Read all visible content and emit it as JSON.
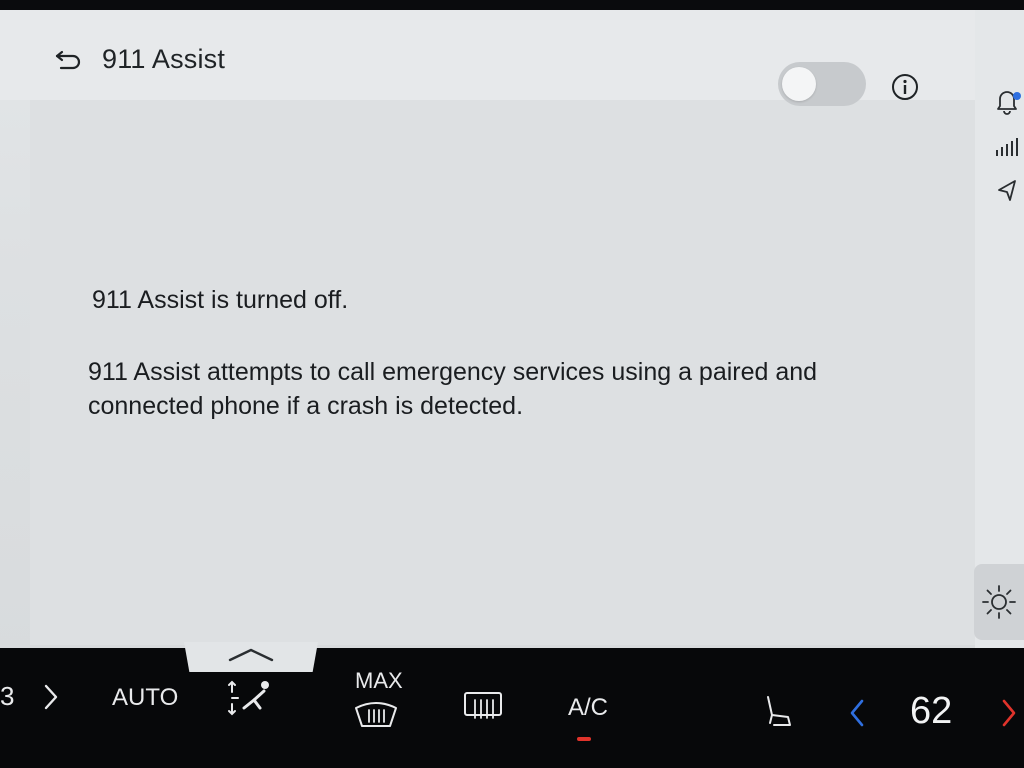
{
  "header": {
    "title": "911 Assist",
    "toggle_state": "off"
  },
  "content": {
    "status": "911 Assist is turned off.",
    "description": "911 Assist attempts to call emergency services using a paired and connected phone if a crash is detected."
  },
  "right_rail": {
    "icons": [
      "bell-icon",
      "signal-icon",
      "navigation-icon",
      "brightness-icon"
    ]
  },
  "climate": {
    "left_fragment": "3",
    "auto_label": "AUTO",
    "max_label": "MAX",
    "ac_label": "A/C",
    "temperature": "62",
    "icons": [
      "chevron-right-icon",
      "airflow-mode-icon",
      "max-defrost-icon",
      "rear-defrost-icon",
      "seat-icon",
      "chevron-left-icon",
      "chevron-right-icon"
    ]
  },
  "colors": {
    "panel_bg": "#dde0e2",
    "text": "#1a1d20",
    "climate_bg": "#07080a",
    "accent_blue": "#2f6fe0",
    "accent_red": "#e0332b",
    "toggle_off": "#c7cacd"
  }
}
